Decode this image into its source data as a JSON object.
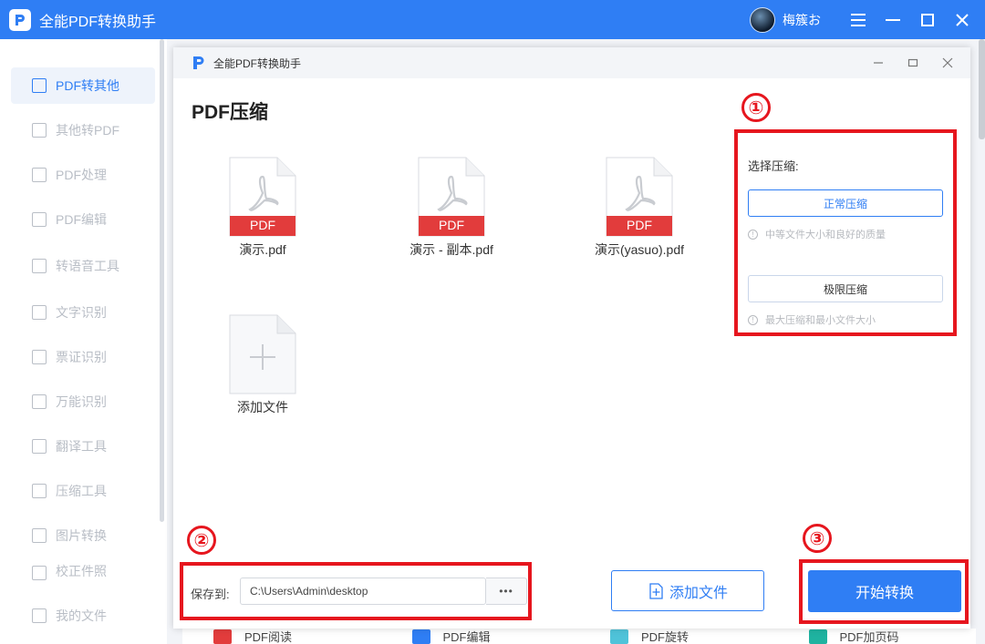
{
  "app": {
    "title": "全能PDF转换助手",
    "username": "梅簇お"
  },
  "sidebar": {
    "items": [
      {
        "label": "PDF转其他",
        "active": true
      },
      {
        "label": "其他转PDF"
      },
      {
        "label": "PDF处理"
      },
      {
        "label": "PDF编辑"
      },
      {
        "label": "转语音工具"
      },
      {
        "label": "文字识别"
      },
      {
        "label": "票证识别"
      },
      {
        "label": "万能识别"
      },
      {
        "label": "翻译工具"
      },
      {
        "label": "压缩工具"
      },
      {
        "label": "图片转换"
      },
      {
        "label": "校正件照"
      },
      {
        "label": "我的文件"
      }
    ]
  },
  "background_tools": [
    "PDF阅读",
    "PDF编辑",
    "PDF旋转",
    "PDF加页码"
  ],
  "dialog": {
    "title": "全能PDF转换助手",
    "heading": "PDF压缩",
    "files": [
      {
        "name": "演示.pdf",
        "badge": "PDF"
      },
      {
        "name": "演示 - 副本.pdf",
        "badge": "PDF"
      },
      {
        "name": "演示(yasuo).pdf",
        "badge": "PDF"
      }
    ],
    "add_file_tile": "添加文件",
    "options": {
      "label": "选择压缩:",
      "normal": {
        "label": "正常压缩",
        "hint": "中等文件大小和良好的质量",
        "selected": true
      },
      "extreme": {
        "label": "极限压缩",
        "hint": "最大压缩和最小文件大小",
        "selected": false
      }
    },
    "save": {
      "label": "保存到:",
      "path": "C:\\Users\\Admin\\desktop",
      "browse": "•••"
    },
    "add_button": "添加文件",
    "start_button": "开始转换"
  },
  "annotations": [
    "①",
    "②",
    "③"
  ],
  "colors": {
    "accent": "#2f7ef4",
    "pdf_red": "#e23c3c",
    "annotation_red": "#e6161e"
  }
}
